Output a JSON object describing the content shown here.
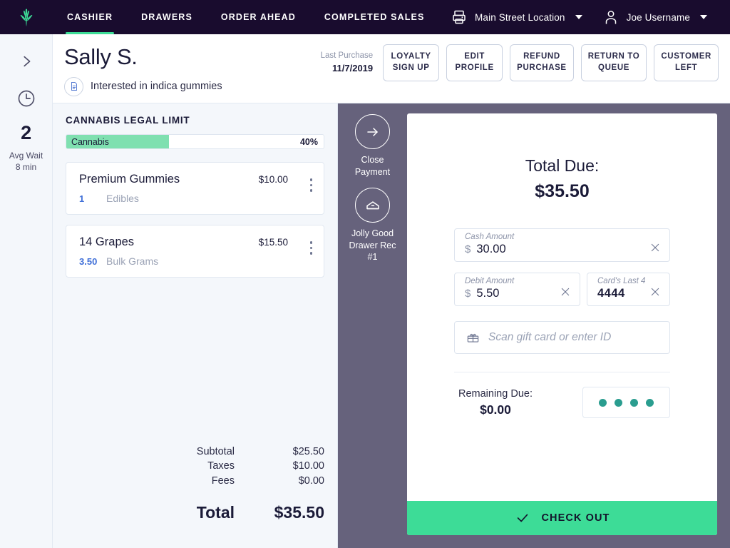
{
  "colors": {
    "nav_bg": "#190c2e",
    "accent_green": "#3ddc97",
    "limit_fill": "#7fe0b0",
    "purple_rail": "#66627c",
    "teal_dot": "#2a9d8f",
    "light_bg": "#f4f7fb",
    "ink": "#1b1b38",
    "qty_blue": "#3f6fd8"
  },
  "topnav": {
    "logo": "cannabis-leaf-logo",
    "tabs": [
      {
        "label": "CASHIER",
        "active": true
      },
      {
        "label": "DRAWERS",
        "active": false
      },
      {
        "label": "ORDER AHEAD",
        "active": false
      },
      {
        "label": "COMPLETED SALES",
        "active": false
      }
    ],
    "location": {
      "icon": "printer-icon",
      "label": "Main Street Location"
    },
    "user": {
      "icon": "user-icon",
      "label": "Joe Username"
    }
  },
  "rail": {
    "expand_icon": "chevron-right-icon",
    "clock_icon": "clock-icon",
    "queue_count": "2",
    "wait_label": "Avg Wait",
    "wait_value": "8 min"
  },
  "customer": {
    "name": "Sally S.",
    "note_icon": "note-icon",
    "note": "Interested in indica gummies",
    "last_purchase_label": "Last Purchase",
    "last_purchase_date": "11/7/2019",
    "buttons": [
      "LOYALTY\nSIGN UP",
      "EDIT\nPROFILE",
      "REFUND\nPURCHASE",
      "RETURN TO\nQUEUE",
      "CUSTOMER\nLEFT"
    ]
  },
  "cart": {
    "title": "CANNABIS LEGAL LIMIT",
    "limit": {
      "label": "Cannabis",
      "percent_label": "40%",
      "percent": 40
    },
    "items": [
      {
        "name": "Premium Gummies",
        "price": "$10.00",
        "qty": "1",
        "category": "Edibles"
      },
      {
        "name": "14 Grapes",
        "price": "$15.50",
        "qty": "3.50",
        "category": "Bulk Grams"
      }
    ],
    "totals": [
      {
        "label": "Subtotal",
        "value": "$25.50"
      },
      {
        "label": "Taxes",
        "value": "$10.00"
      },
      {
        "label": "Fees",
        "value": "$0.00"
      }
    ],
    "grand": {
      "label": "Total",
      "value": "$35.50"
    }
  },
  "actions": [
    {
      "icon": "arrow-right-icon",
      "label": "Close\nPayment"
    },
    {
      "icon": "drawer-icon",
      "label": "Jolly Good\nDrawer Rec\n#1"
    }
  ],
  "payment": {
    "total_due_label": "Total Due:",
    "total_due_value": "$35.50",
    "cash": {
      "label": "Cash Amount",
      "currency": "$",
      "value": "30.00",
      "clear_icon": "close-icon"
    },
    "debit": {
      "label": "Debit Amount",
      "currency": "$",
      "value": "5.50",
      "clear_icon": "close-icon"
    },
    "last4": {
      "label": "Card's Last 4",
      "value": "4444",
      "clear_icon": "close-icon"
    },
    "gift": {
      "icon": "gift-card-icon",
      "placeholder": "Scan gift card or enter ID",
      "value": ""
    },
    "remaining_label": "Remaining Due:",
    "remaining_value": "$0.00",
    "pin_dots": 4,
    "checkout": {
      "icon": "check-icon",
      "label": "CHECK OUT"
    }
  }
}
